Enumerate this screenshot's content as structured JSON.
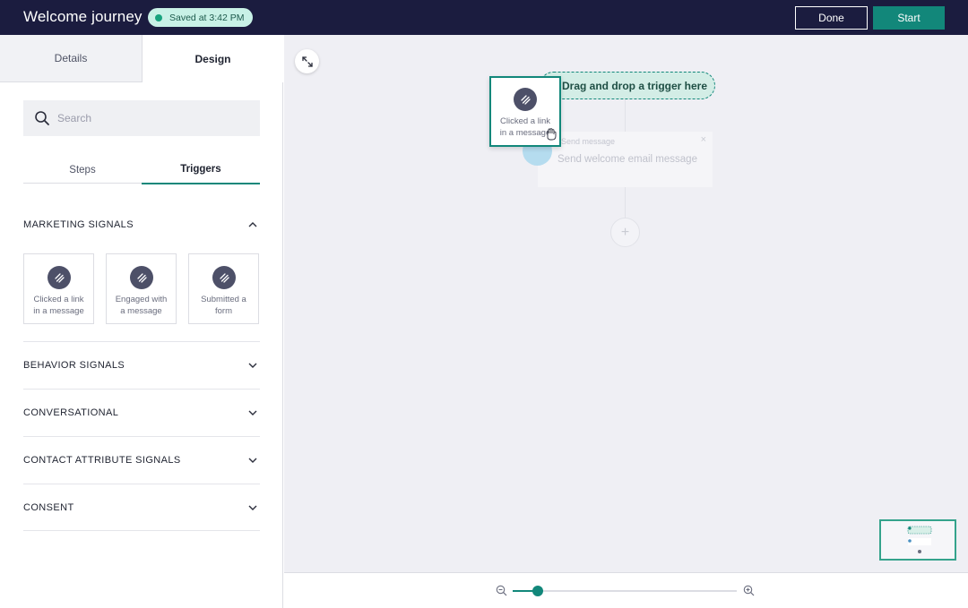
{
  "app": {
    "title": "Welcome journey",
    "saved_label": "Saved at 3:42 PM",
    "done_label": "Done",
    "start_label": "Start"
  },
  "sidebar": {
    "tabs": [
      {
        "label": "Details",
        "active": false
      },
      {
        "label": "Design",
        "active": true
      }
    ],
    "search": {
      "placeholder": "Search",
      "value": ""
    },
    "sub_tabs": [
      {
        "label": "Steps",
        "active": false
      },
      {
        "label": "Triggers",
        "active": true
      }
    ],
    "sections": [
      {
        "label": "MARKETING SIGNALS",
        "expanded": true
      },
      {
        "label": "BEHAVIOR SIGNALS",
        "expanded": false
      },
      {
        "label": "CONVERSATIONAL",
        "expanded": false
      },
      {
        "label": "CONTACT ATTRIBUTE SIGNALS",
        "expanded": false
      },
      {
        "label": "CONSENT",
        "expanded": false
      }
    ],
    "marketing_cards": [
      {
        "line1": "Clicked a link",
        "line2": "in a message",
        "icon": "link-signal-icon"
      },
      {
        "line1": "Engaged with",
        "line2": "a message",
        "icon": "link-signal-icon"
      },
      {
        "line1": "Submitted a",
        "line2": "form",
        "icon": "link-signal-icon"
      }
    ]
  },
  "canvas": {
    "dropzone_label": "Drag and drop a trigger here",
    "step_node": {
      "title": "Send message",
      "text": "Send welcome email message",
      "close": "×"
    },
    "add_step": "+",
    "dragging_card": {
      "line1": "Clicked a link",
      "line2": "in a message"
    }
  },
  "zoom": {
    "level_fraction": 0.11
  },
  "colors": {
    "topbar": "#1b1c3f",
    "accent": "#12877a",
    "saved_badge": "#c8f1e6",
    "canvas": "#efeff4"
  }
}
